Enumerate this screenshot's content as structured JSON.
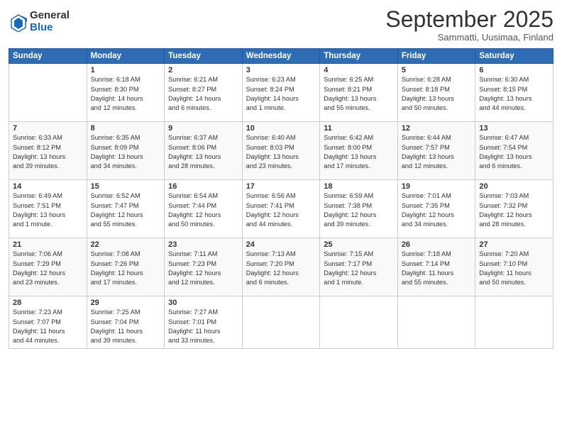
{
  "header": {
    "logo_general": "General",
    "logo_blue": "Blue",
    "month_title": "September 2025",
    "subtitle": "Sammatti, Uusimaa, Finland"
  },
  "columns": [
    "Sunday",
    "Monday",
    "Tuesday",
    "Wednesday",
    "Thursday",
    "Friday",
    "Saturday"
  ],
  "weeks": [
    [
      {
        "num": "",
        "info": ""
      },
      {
        "num": "1",
        "info": "Sunrise: 6:18 AM\nSunset: 8:30 PM\nDaylight: 14 hours\nand 12 minutes."
      },
      {
        "num": "2",
        "info": "Sunrise: 6:21 AM\nSunset: 8:27 PM\nDaylight: 14 hours\nand 6 minutes."
      },
      {
        "num": "3",
        "info": "Sunrise: 6:23 AM\nSunset: 8:24 PM\nDaylight: 14 hours\nand 1 minute."
      },
      {
        "num": "4",
        "info": "Sunrise: 6:25 AM\nSunset: 8:21 PM\nDaylight: 13 hours\nand 55 minutes."
      },
      {
        "num": "5",
        "info": "Sunrise: 6:28 AM\nSunset: 8:18 PM\nDaylight: 13 hours\nand 50 minutes."
      },
      {
        "num": "6",
        "info": "Sunrise: 6:30 AM\nSunset: 8:15 PM\nDaylight: 13 hours\nand 44 minutes."
      }
    ],
    [
      {
        "num": "7",
        "info": "Sunrise: 6:33 AM\nSunset: 8:12 PM\nDaylight: 13 hours\nand 39 minutes."
      },
      {
        "num": "8",
        "info": "Sunrise: 6:35 AM\nSunset: 8:09 PM\nDaylight: 13 hours\nand 34 minutes."
      },
      {
        "num": "9",
        "info": "Sunrise: 6:37 AM\nSunset: 8:06 PM\nDaylight: 13 hours\nand 28 minutes."
      },
      {
        "num": "10",
        "info": "Sunrise: 6:40 AM\nSunset: 8:03 PM\nDaylight: 13 hours\nand 23 minutes."
      },
      {
        "num": "11",
        "info": "Sunrise: 6:42 AM\nSunset: 8:00 PM\nDaylight: 13 hours\nand 17 minutes."
      },
      {
        "num": "12",
        "info": "Sunrise: 6:44 AM\nSunset: 7:57 PM\nDaylight: 13 hours\nand 12 minutes."
      },
      {
        "num": "13",
        "info": "Sunrise: 6:47 AM\nSunset: 7:54 PM\nDaylight: 13 hours\nand 6 minutes."
      }
    ],
    [
      {
        "num": "14",
        "info": "Sunrise: 6:49 AM\nSunset: 7:51 PM\nDaylight: 13 hours\nand 1 minute."
      },
      {
        "num": "15",
        "info": "Sunrise: 6:52 AM\nSunset: 7:47 PM\nDaylight: 12 hours\nand 55 minutes."
      },
      {
        "num": "16",
        "info": "Sunrise: 6:54 AM\nSunset: 7:44 PM\nDaylight: 12 hours\nand 50 minutes."
      },
      {
        "num": "17",
        "info": "Sunrise: 6:56 AM\nSunset: 7:41 PM\nDaylight: 12 hours\nand 44 minutes."
      },
      {
        "num": "18",
        "info": "Sunrise: 6:59 AM\nSunset: 7:38 PM\nDaylight: 12 hours\nand 39 minutes."
      },
      {
        "num": "19",
        "info": "Sunrise: 7:01 AM\nSunset: 7:35 PM\nDaylight: 12 hours\nand 34 minutes."
      },
      {
        "num": "20",
        "info": "Sunrise: 7:03 AM\nSunset: 7:32 PM\nDaylight: 12 hours\nand 28 minutes."
      }
    ],
    [
      {
        "num": "21",
        "info": "Sunrise: 7:06 AM\nSunset: 7:29 PM\nDaylight: 12 hours\nand 23 minutes."
      },
      {
        "num": "22",
        "info": "Sunrise: 7:08 AM\nSunset: 7:26 PM\nDaylight: 12 hours\nand 17 minutes."
      },
      {
        "num": "23",
        "info": "Sunrise: 7:11 AM\nSunset: 7:23 PM\nDaylight: 12 hours\nand 12 minutes."
      },
      {
        "num": "24",
        "info": "Sunrise: 7:13 AM\nSunset: 7:20 PM\nDaylight: 12 hours\nand 6 minutes."
      },
      {
        "num": "25",
        "info": "Sunrise: 7:15 AM\nSunset: 7:17 PM\nDaylight: 12 hours\nand 1 minute."
      },
      {
        "num": "26",
        "info": "Sunrise: 7:18 AM\nSunset: 7:14 PM\nDaylight: 11 hours\nand 55 minutes."
      },
      {
        "num": "27",
        "info": "Sunrise: 7:20 AM\nSunset: 7:10 PM\nDaylight: 11 hours\nand 50 minutes."
      }
    ],
    [
      {
        "num": "28",
        "info": "Sunrise: 7:23 AM\nSunset: 7:07 PM\nDaylight: 11 hours\nand 44 minutes."
      },
      {
        "num": "29",
        "info": "Sunrise: 7:25 AM\nSunset: 7:04 PM\nDaylight: 11 hours\nand 39 minutes."
      },
      {
        "num": "30",
        "info": "Sunrise: 7:27 AM\nSunset: 7:01 PM\nDaylight: 11 hours\nand 33 minutes."
      },
      {
        "num": "",
        "info": ""
      },
      {
        "num": "",
        "info": ""
      },
      {
        "num": "",
        "info": ""
      },
      {
        "num": "",
        "info": ""
      }
    ]
  ]
}
